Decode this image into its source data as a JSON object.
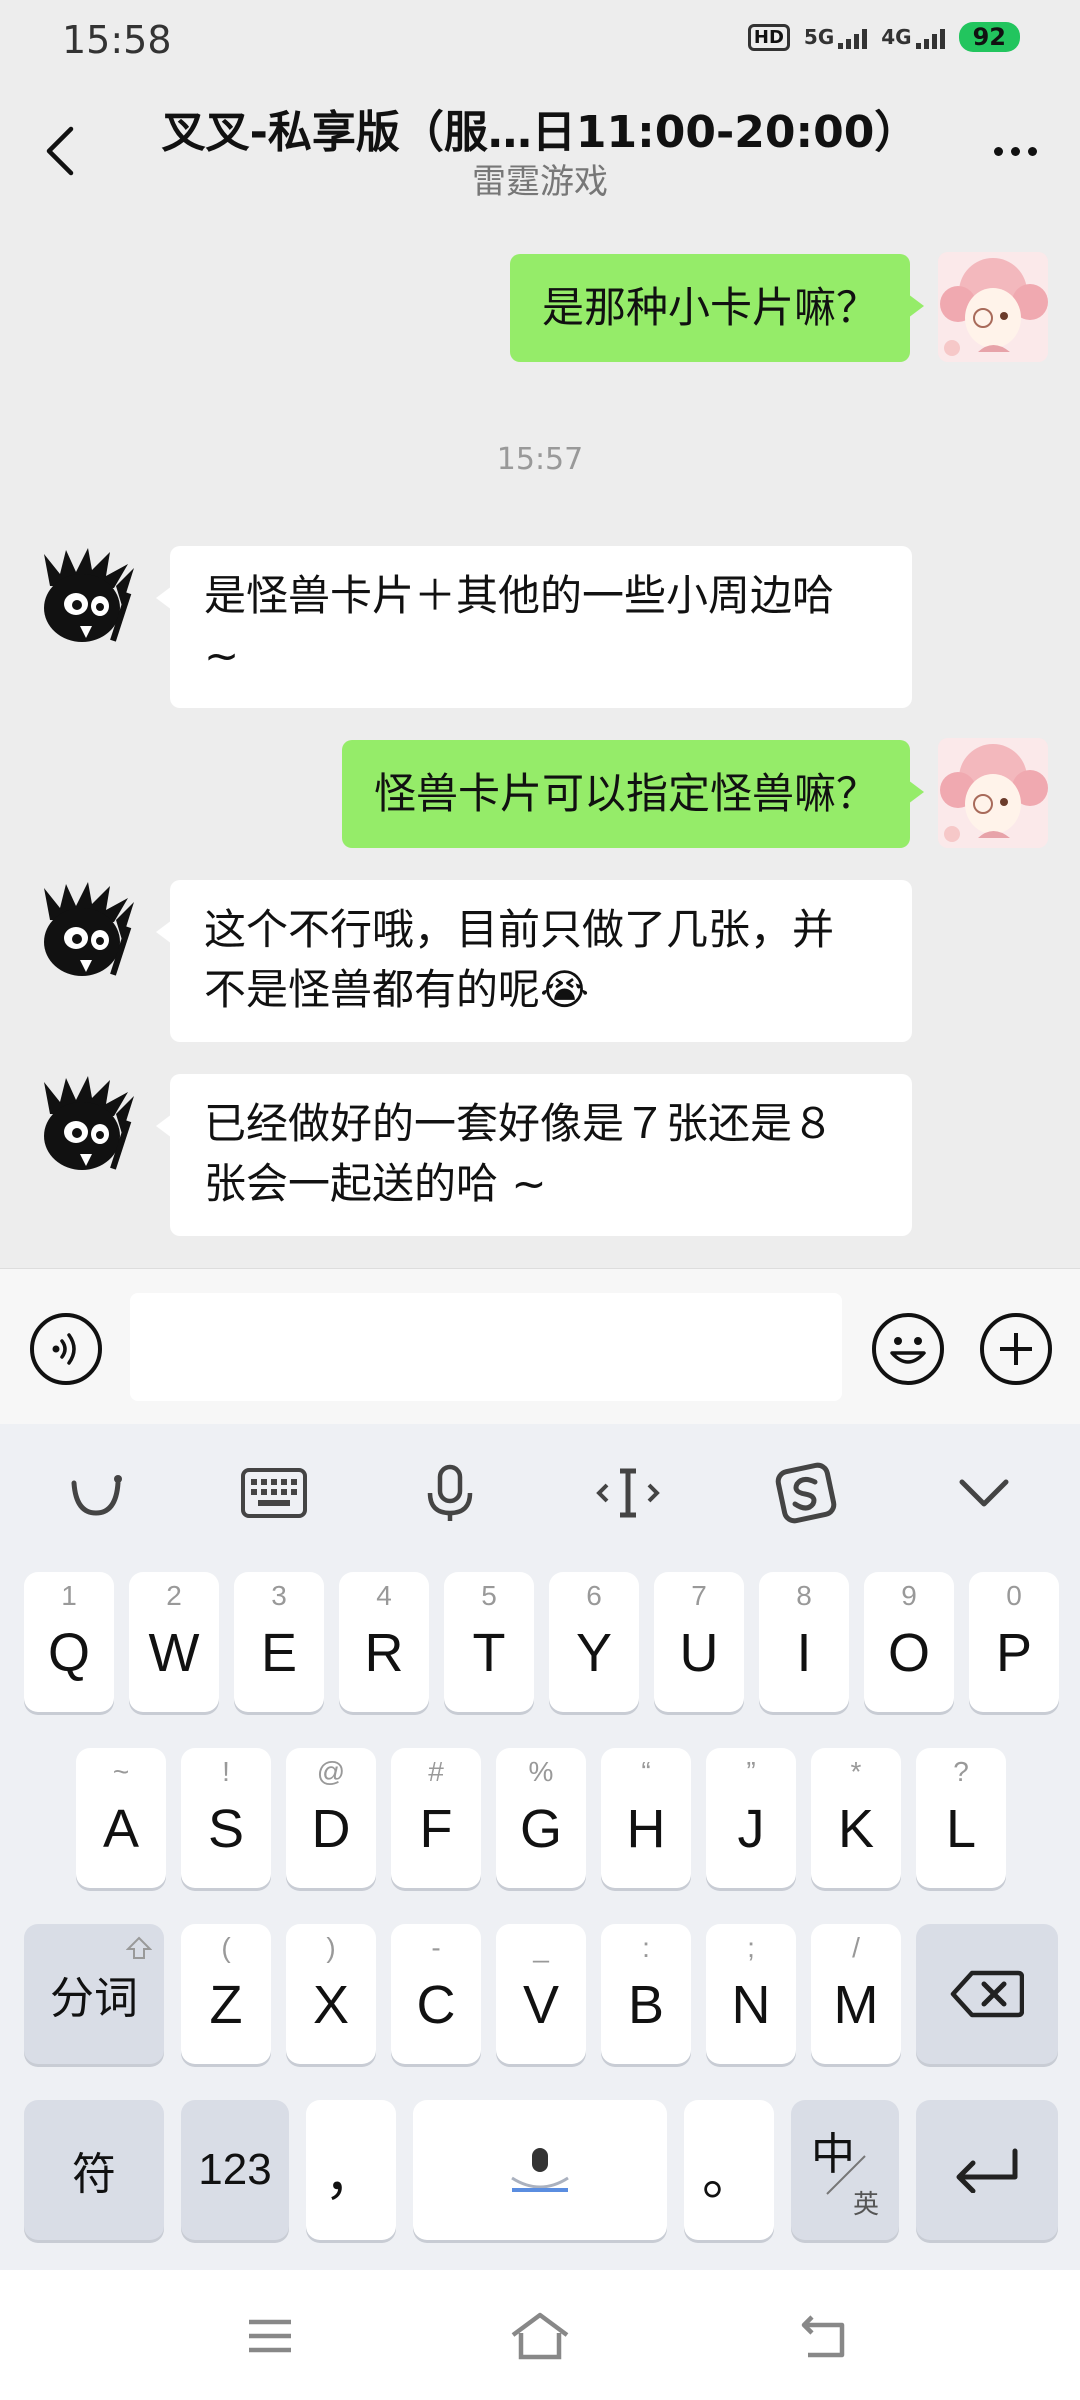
{
  "status_bar": {
    "time": "15:58",
    "hd_label": "HD",
    "net1": "5G",
    "net2": "4G",
    "battery": "92",
    "battery_color": "#22c55e"
  },
  "header": {
    "title": "叉叉-私享版（服…日11:00-20:00）",
    "subtitle": "雷霆游戏"
  },
  "messages": {
    "m1": "是那种小卡片嘛？",
    "time_divider": "15:57",
    "m2_line1": "是怪兽卡片＋其他的一些小周边哈",
    "m2_line2": "~",
    "m3": "怪兽卡片可以指定怪兽嘛？",
    "m4_line1": "这个不行哦，目前只做了几张，并",
    "m4_line2": "不是怪兽都有的呢😭",
    "m5_line1": "已经做好的一套好像是７张还是８",
    "m5_line2": "张会一起送的哈 ~"
  },
  "colors": {
    "outgoing_bubble": "#95ec69",
    "incoming_bubble": "#ffffff",
    "background": "#ededed"
  },
  "input": {
    "value": "",
    "placeholder": ""
  },
  "keyboard": {
    "row1": [
      {
        "hint": "1",
        "key": "Q"
      },
      {
        "hint": "2",
        "key": "W"
      },
      {
        "hint": "3",
        "key": "E"
      },
      {
        "hint": "4",
        "key": "R"
      },
      {
        "hint": "5",
        "key": "T"
      },
      {
        "hint": "6",
        "key": "Y"
      },
      {
        "hint": "7",
        "key": "U"
      },
      {
        "hint": "8",
        "key": "I"
      },
      {
        "hint": "9",
        "key": "O"
      },
      {
        "hint": "0",
        "key": "P"
      }
    ],
    "row2": [
      {
        "hint": "~",
        "key": "A"
      },
      {
        "hint": "!",
        "key": "S"
      },
      {
        "hint": "@",
        "key": "D"
      },
      {
        "hint": "#",
        "key": "F"
      },
      {
        "hint": "%",
        "key": "G"
      },
      {
        "hint": "“",
        "key": "H"
      },
      {
        "hint": "”",
        "key": "J"
      },
      {
        "hint": "*",
        "key": "K"
      },
      {
        "hint": "?",
        "key": "L"
      }
    ],
    "row3": [
      {
        "hint": "(",
        "key": "Z"
      },
      {
        "hint": ")",
        "key": "X"
      },
      {
        "hint": "-",
        "key": "C"
      },
      {
        "hint": "_",
        "key": "V"
      },
      {
        "hint": ":",
        "key": "B"
      },
      {
        "hint": ";",
        "key": "N"
      },
      {
        "hint": "/",
        "key": "M"
      }
    ],
    "segment_key": "分词",
    "symbol_key": "符",
    "num_key": "123",
    "comma_key": "，",
    "period_key": "。",
    "lang_key_main": "中",
    "lang_key_sub": "英"
  }
}
